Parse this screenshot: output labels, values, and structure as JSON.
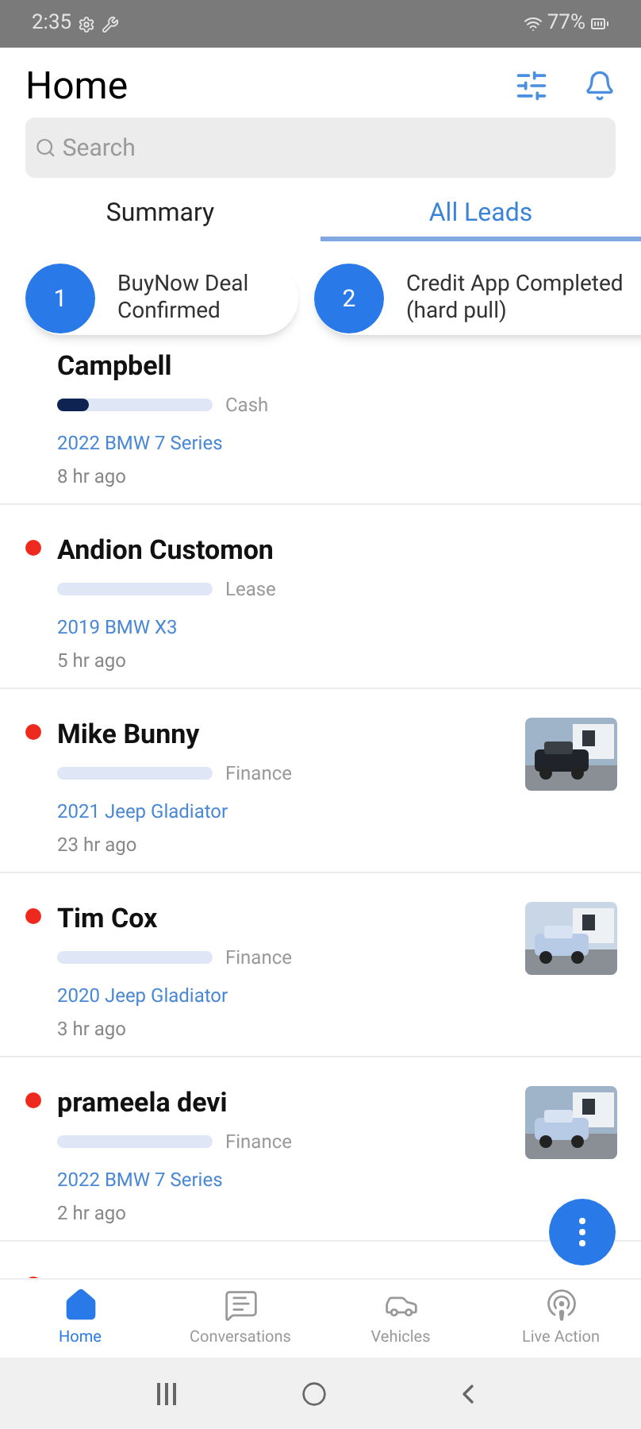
{
  "status_bar": {
    "time": "2:35",
    "battery": "77%"
  },
  "header": {
    "title": "Home"
  },
  "search": {
    "placeholder": "Search"
  },
  "tabs": [
    {
      "label": "Summary",
      "selected": false
    },
    {
      "label": "All Leads",
      "selected": true
    }
  ],
  "steps": [
    {
      "number": "1",
      "label": "BuyNow Deal Confirmed"
    },
    {
      "number": "2",
      "label": "Credit App Completed (hard pull)"
    }
  ],
  "leads": [
    {
      "name": "Campbell",
      "level": 0.2,
      "deal_type": "Cash",
      "vehicle": "2022 BMW 7 Series",
      "time": "8 hr ago"
    },
    {
      "name": "Andion Customon",
      "unread": true,
      "deal_type": "Lease",
      "vehicle": "2019 BMW X3",
      "time": "5 hr ago"
    },
    {
      "name": "Mike Bunny",
      "unread": true,
      "deal_type": "Finance",
      "vehicle": "2021 Jeep Gladiator",
      "time": "23 hr ago",
      "photo": true
    },
    {
      "name": "Tim Cox",
      "unread": true,
      "deal_type": "Finance",
      "vehicle": "2020 Jeep Gladiator",
      "time": "3 hr ago",
      "photo": true
    },
    {
      "name": "prameela devi",
      "unread": true,
      "deal_type": "Finance",
      "vehicle": "2022 BMW 7 Series",
      "time": "2 hr ago",
      "photo": true
    },
    {
      "unread": true
    }
  ],
  "bottom_nav": [
    {
      "label": "Home",
      "selected": true
    },
    {
      "label": "Conversations",
      "selected": false
    },
    {
      "label": "Vehicles",
      "selected": false
    },
    {
      "label": "Live Action",
      "selected": false
    }
  ]
}
